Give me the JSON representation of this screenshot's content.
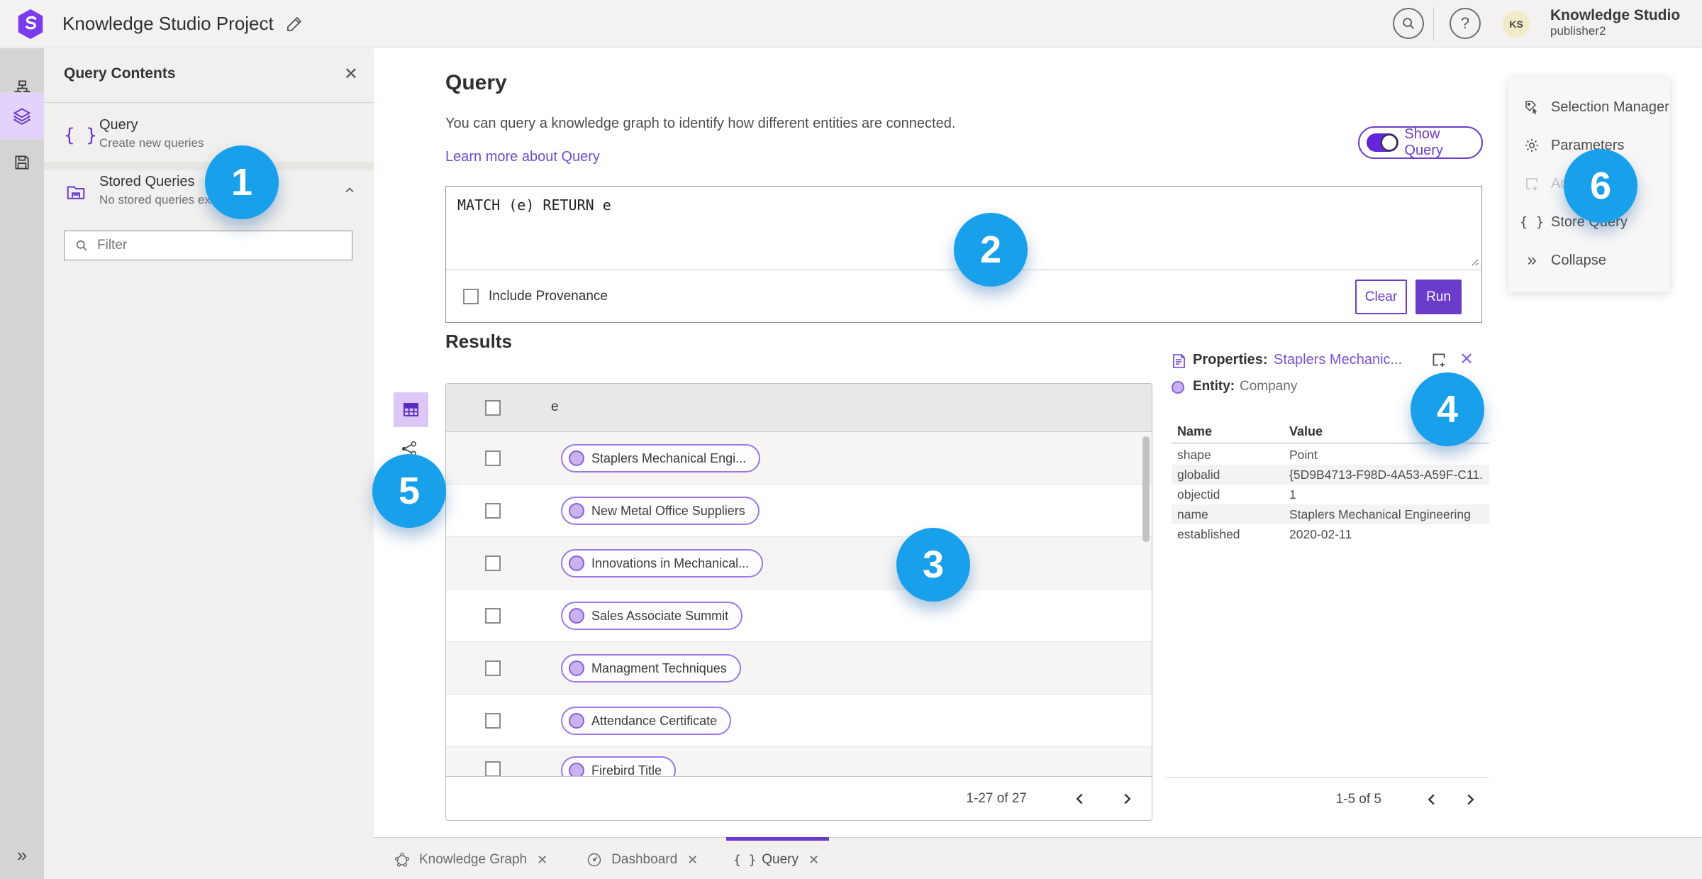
{
  "colors": {
    "accent": "#6a3cc9",
    "annotation_blue": "#18a0ea",
    "link_purple": "#6d4bd1"
  },
  "topbar": {
    "title": "Knowledge Studio Project",
    "user": {
      "name": "Knowledge Studio",
      "sub": "publisher2",
      "initials": "KS"
    }
  },
  "contents_panel": {
    "title": "Query Contents",
    "query_item": {
      "title": "Query",
      "subtitle": "Create new queries"
    },
    "stored_item": {
      "title": "Stored Queries",
      "subtitle": "No stored queries exist"
    },
    "filter_placeholder": "Filter"
  },
  "query_section": {
    "heading": "Query",
    "description": "You can query a knowledge graph to identify how different entities are connected.",
    "learn_more": "Learn more about Query",
    "show_query_label": "Show Query",
    "show_query_on": true,
    "query_text": "MATCH (e) RETURN e",
    "include_provenance_label": "Include Provenance",
    "include_provenance_checked": false,
    "clear_label": "Clear",
    "run_label": "Run"
  },
  "results": {
    "heading": "Results",
    "column_header": "e",
    "rows": [
      "Staplers Mechanical Engi...",
      "New Metal Office Suppliers",
      "Innovations in Mechanical...",
      "Sales Associate Summit",
      "Managment Techniques",
      "Attendance Certificate",
      "Firebird Title"
    ],
    "pagination": {
      "range": "1-27 of 27"
    }
  },
  "properties_panel": {
    "title": "Properties:",
    "entity_link": "Staplers Mechanic...",
    "entity_label": "Entity:",
    "entity_type": "Company",
    "headers": {
      "name": "Name",
      "value": "Value"
    },
    "rows": [
      {
        "name": "shape",
        "value": "Point"
      },
      {
        "name": "globalid",
        "value": "{5D9B4713-F98D-4A53-A59F-C11..."
      },
      {
        "name": "objectid",
        "value": "1"
      },
      {
        "name": "name",
        "value": "Staplers Mechanical Engineering"
      },
      {
        "name": "established",
        "value": "2020-02-11"
      }
    ],
    "pagination": {
      "range": "1-5 of 5"
    }
  },
  "side_menu": {
    "items": [
      {
        "label": "Selection Manager",
        "disabled": false
      },
      {
        "label": "Parameters",
        "disabled": false
      },
      {
        "label": "Ad",
        "disabled": true
      },
      {
        "label": "Store Query",
        "disabled": false
      },
      {
        "label": "Collapse",
        "disabled": false
      }
    ]
  },
  "bottom_tabs": [
    {
      "label": "Knowledge Graph"
    },
    {
      "label": "Dashboard"
    },
    {
      "label": "Query"
    }
  ],
  "annotations": [
    "1",
    "2",
    "3",
    "4",
    "5",
    "6"
  ]
}
